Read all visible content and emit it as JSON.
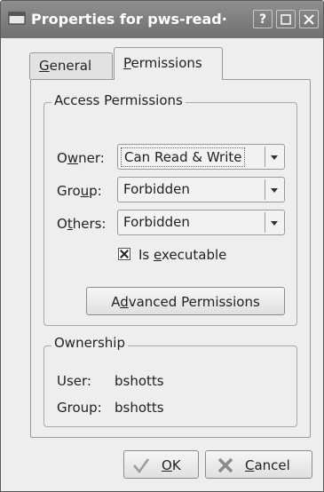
{
  "window": {
    "title": "Properties for pws-read·",
    "help_label": "?"
  },
  "tabs": {
    "general": {
      "pre": "",
      "mnemonic": "G",
      "post": "eneral"
    },
    "permissions": {
      "pre": "",
      "mnemonic": "P",
      "post": "ermissions"
    }
  },
  "access": {
    "legend": "Access Permissions",
    "owner": {
      "pre": "O",
      "mnemonic": "w",
      "post": "ner:",
      "value": "Can Read & Write"
    },
    "group": {
      "pre": "Gro",
      "mnemonic": "u",
      "post": "p:",
      "value": "Forbidden"
    },
    "others": {
      "pre": "O",
      "mnemonic": "t",
      "post": "hers:",
      "value": "Forbidden"
    },
    "executable": {
      "pre": "Is ",
      "mnemonic": "e",
      "post": "xecutable",
      "checked": true
    },
    "advanced": {
      "pre": "A",
      "mnemonic": "d",
      "post": "vanced Permissions"
    }
  },
  "ownership": {
    "legend": "Ownership",
    "user_label": "User:",
    "user_value": "bshotts",
    "group_label": "Group:",
    "group_value": "bshotts"
  },
  "buttons": {
    "ok": {
      "pre": "",
      "mnemonic": "O",
      "post": "K"
    },
    "cancel": {
      "pre": "",
      "mnemonic": "C",
      "post": "ancel"
    }
  },
  "icons": {
    "window": "dialog-window-icon",
    "ok": "checkmark-icon",
    "cancel": "cross-icon"
  }
}
